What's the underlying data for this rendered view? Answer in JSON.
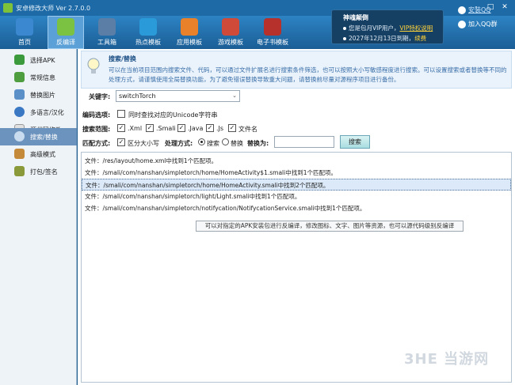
{
  "window": {
    "title": "安卓修改大师 Ver 2.7.0.0",
    "buttons": [
      "-",
      "□",
      "✕"
    ]
  },
  "toolbar": {
    "items": [
      {
        "label": "首页",
        "color": "#3c88d0"
      },
      {
        "label": "反编译",
        "color": "#7cc242"
      },
      {
        "label": "工具箱",
        "color": "#5a7ea6"
      },
      {
        "label": "热点模板",
        "color": "#2a9bd8"
      },
      {
        "label": "应用模板",
        "color": "#e9812a"
      },
      {
        "label": "游戏模板",
        "color": "#d04a3a"
      },
      {
        "label": "电子书模板",
        "color": "#b7312c"
      }
    ]
  },
  "vip": {
    "title": "神魂颠倒",
    "line1_prefix": "您是包月VIP用户，",
    "line1_link": "VIP特权说明",
    "line2_prefix": "2027年12月13日到期，",
    "line2_link": "续费"
  },
  "rightlinks": {
    "qq": "安装QQ",
    "group": "加入QQ群"
  },
  "sidebar": {
    "items": [
      {
        "label": "选择APK",
        "color": "#3b9a3b"
      },
      {
        "label": "常规信息",
        "color": "#4e9e3f"
      },
      {
        "label": "替换图片",
        "color": "#5a8fc8"
      },
      {
        "label": "多语言/汉化",
        "color": "#3a78c4"
      },
      {
        "label": "源代码修改",
        "color": "#e0e0e0"
      },
      {
        "label": "搜索/替换",
        "color": "#7aa0c8"
      },
      {
        "label": "高级模式",
        "color": "#c48a3a"
      },
      {
        "label": "打包/签名",
        "color": "#8a9a3a"
      }
    ]
  },
  "header": {
    "title": "搜索/替换",
    "description": "可以在当前项目范围内搜索文件、代码，可以通过文件扩展名进行搜索条件筛选，也可以按照大小写敏感程度进行搜索。可以设置搜索或者替换等不同的处理方式，请谨慎使用全局替换功能，为了避免错误替换导致重大问题，请替换前尽量对源程序项目进行备份。"
  },
  "form": {
    "keyword_label": "关键字:",
    "keyword_value": "switchTorch",
    "encode_label": "编码选项:",
    "encode_option": "同时查找对应的Unicode字符串",
    "scope_label": "搜索范围:",
    "scope_options": [
      ".Xml",
      ".Smali",
      ".Java",
      ".Js",
      "文件名"
    ],
    "match_label": "匹配方式:",
    "match_option": "区分大小写",
    "process_label": "处理方式:",
    "process_search": "搜索",
    "process_replace": "替换",
    "replace_label": "替换为:",
    "search_button": "搜索"
  },
  "results": [
    "文件：/res/layout/home.xml中找到1个匹配项。",
    "文件：/smali/com/nanshan/simpletorch/home/HomeActivity$1.smali中找到1个匹配项。",
    "文件：/smali/com/nanshan/simpletorch/home/HomeActivity.smali中找到2个匹配项。",
    "文件：/smali/com/nanshan/simpletorch/light/Light.smali中找到1个匹配项。",
    "文件：/smali/com/nanshan/simpletorch/notifycation/NotifycationService.smali中找到1个匹配项。"
  ],
  "tooltip": "可以对指定的APK安装包进行反编译，修改图标、文字、图片等资源，也可以源代码级别反编译",
  "watermark": "3HE 当游网"
}
